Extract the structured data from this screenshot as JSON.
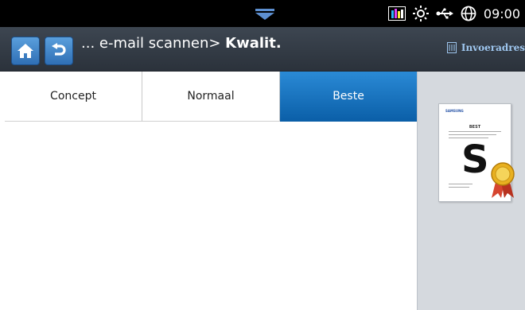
{
  "status": {
    "time": "09:00",
    "icons": [
      "toner-level-icon",
      "brightness-icon",
      "usb-icon",
      "network-globe-icon"
    ]
  },
  "header": {
    "breadcrumb_prefix": "... e-mail scannen> ",
    "breadcrumb_current": "Kwalit.",
    "address_book_label": "Invoeradres",
    "accent": "#3a84cc"
  },
  "tabs": [
    {
      "label": "Concept",
      "selected": false
    },
    {
      "label": "Normaal",
      "selected": false
    },
    {
      "label": "Beste",
      "selected": true
    }
  ],
  "preview": {
    "brand": "SAMSUNG",
    "title": "BEST",
    "letter": "S"
  }
}
